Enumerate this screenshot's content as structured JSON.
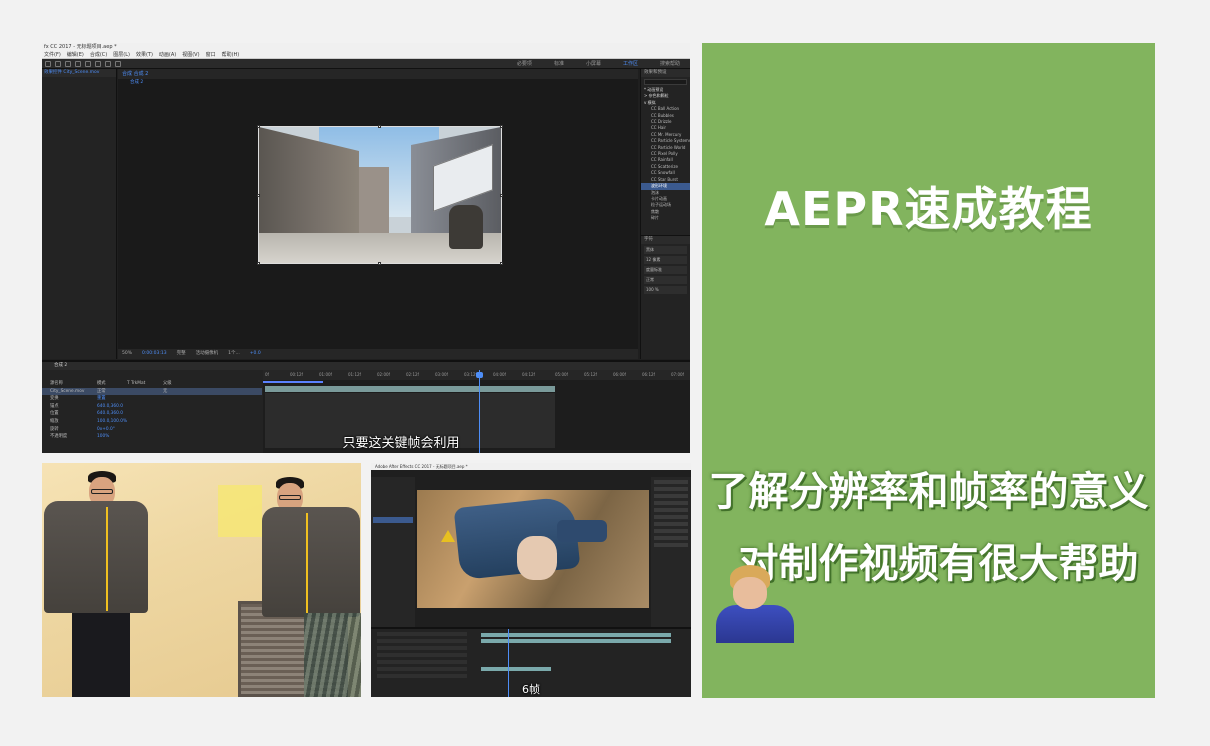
{
  "main_screenshot": {
    "window_title": "fx CC 2017 - 无标题项目.aep *",
    "menu": [
      "文件(F)",
      "编辑(E)",
      "合成(C)",
      "图层(L)",
      "效果(T)",
      "动画(A)",
      "视图(V)",
      "窗口",
      "帮助(H)"
    ],
    "workspaces": [
      "必要项",
      "标准",
      "小屏幕",
      "工作区",
      "搜索帮助"
    ],
    "active_workspace": "工作区",
    "project_tab": "效果控件 City_Scene.mov",
    "comp_tab": "合成 合成 2",
    "comp_crumb": "合成 2",
    "viewer_bar": [
      "50%",
      "0:00:03:13",
      "完整",
      "活动摄像机",
      "1个...",
      "+0.0"
    ],
    "effects_panel_title": "效果和预设",
    "effects_categories": [
      "* 动画预设",
      "> 杂色和颗粒",
      "v 模拟"
    ],
    "effects_items": [
      "CC Ball Action",
      "CC Bubbles",
      "CC Drizzle",
      "CC Hair",
      "CC Mr. Mercury",
      "CC Particle Systems II",
      "CC Particle World",
      "CC Pixel Polly",
      "CC Rainfall",
      "CC Scatterize",
      "CC Snowfall",
      "CC Star Burst",
      "波形环境",
      "泡沫",
      "卡片动画",
      "粒子运动场",
      "焦散",
      "碎片"
    ],
    "effects_selected": "波形环境",
    "char_panel_title": "字符",
    "char_rows": [
      "黑体",
      "12 像素",
      "度量标准",
      "正常",
      "100 %"
    ],
    "timeline_tab": "合成 2",
    "timeline_ruler": [
      "0f",
      "00:12f",
      "01:00f",
      "01:12f",
      "02:00f",
      "02:12f",
      "03:00f",
      "03:12f",
      "04:00f",
      "04:12f",
      "05:00f",
      "05:12f",
      "06:00f",
      "06:12f",
      "07:00f"
    ],
    "layer_header": [
      "源名称",
      "模式",
      "T TrkMat",
      "父级"
    ],
    "layer_name": "City_Scene.mov",
    "layer_mode": "正常",
    "layer_parent": "无",
    "transform_rows": [
      {
        "name": "变换",
        "value": "重置"
      },
      {
        "name": "锚点",
        "value": "640.0,360.0"
      },
      {
        "name": "位置",
        "value": "640.0,360.0"
      },
      {
        "name": "缩放",
        "value": "100.0,100.0%"
      },
      {
        "name": "旋转",
        "value": "0x+0.0°"
      },
      {
        "name": "不透明度",
        "value": "100%"
      }
    ],
    "subtitle": "只要这关键帧会利用"
  },
  "bottom_right_screenshot": {
    "window_title": "Adobe After Effects CC 2017 - 无标题项目.aep *",
    "subtitle": "6帧"
  },
  "promo": {
    "title": "AEPR速成教程",
    "line1": "了解分辨率和帧率的意义",
    "line2": "对制作视频有很大帮助",
    "background_color": "#82b45e"
  }
}
